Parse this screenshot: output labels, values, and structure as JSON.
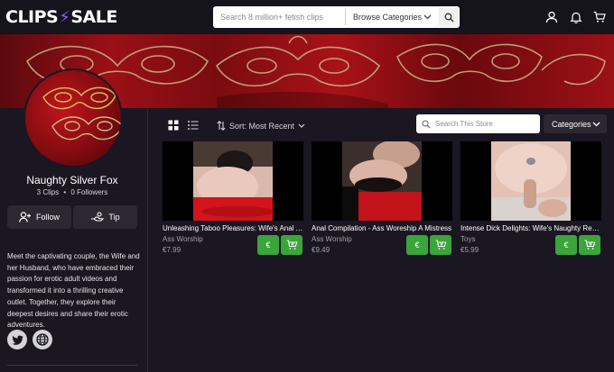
{
  "header": {
    "logo_left": "CLIPS",
    "logo_right": "SALE",
    "search_placeholder": "Search 8 million+ fetish clips",
    "browse_label": "Browse Categories",
    "icons": [
      "search-icon",
      "user-icon",
      "bell-icon",
      "cart-icon"
    ]
  },
  "store": {
    "name": "Naughty Silver Fox",
    "clips": "3 Clips",
    "separator": "•",
    "followers": "0 Followers",
    "follow_label": "Follow",
    "tip_label": "Tip",
    "bio": "Meet the captivating couple, the Wife and her Husband, who have embraced their passion for erotic adult videos and transformed it into a thrilling creative outlet. Together, they explore their deepest desires and share their erotic adventures.",
    "social": [
      "twitter-icon",
      "globe-icon"
    ]
  },
  "toolbar": {
    "sort_label": "Sort: Most Recent",
    "store_search_placeholder": "Search This Store",
    "categories_label": "Categories"
  },
  "clips": [
    {
      "title": "Unleashing Taboo Pleasures: Wife's Anal Adventure",
      "category": "Ass Worship",
      "price": "€7.99",
      "buy_label": "€"
    },
    {
      "title": "Anal Compilation - Ass Woreship A Mistress",
      "category": "Ass Worship",
      "price": "€9.49",
      "buy_label": "€"
    },
    {
      "title": "Intense Dick Delights: Wife's Naughty Reward",
      "category": "Toys",
      "price": "€5.99",
      "buy_label": "€"
    }
  ],
  "colors": {
    "accent": "#8b5cf6",
    "buy": "#3aa53a",
    "background": "#1a1622",
    "header": "#15131c"
  }
}
